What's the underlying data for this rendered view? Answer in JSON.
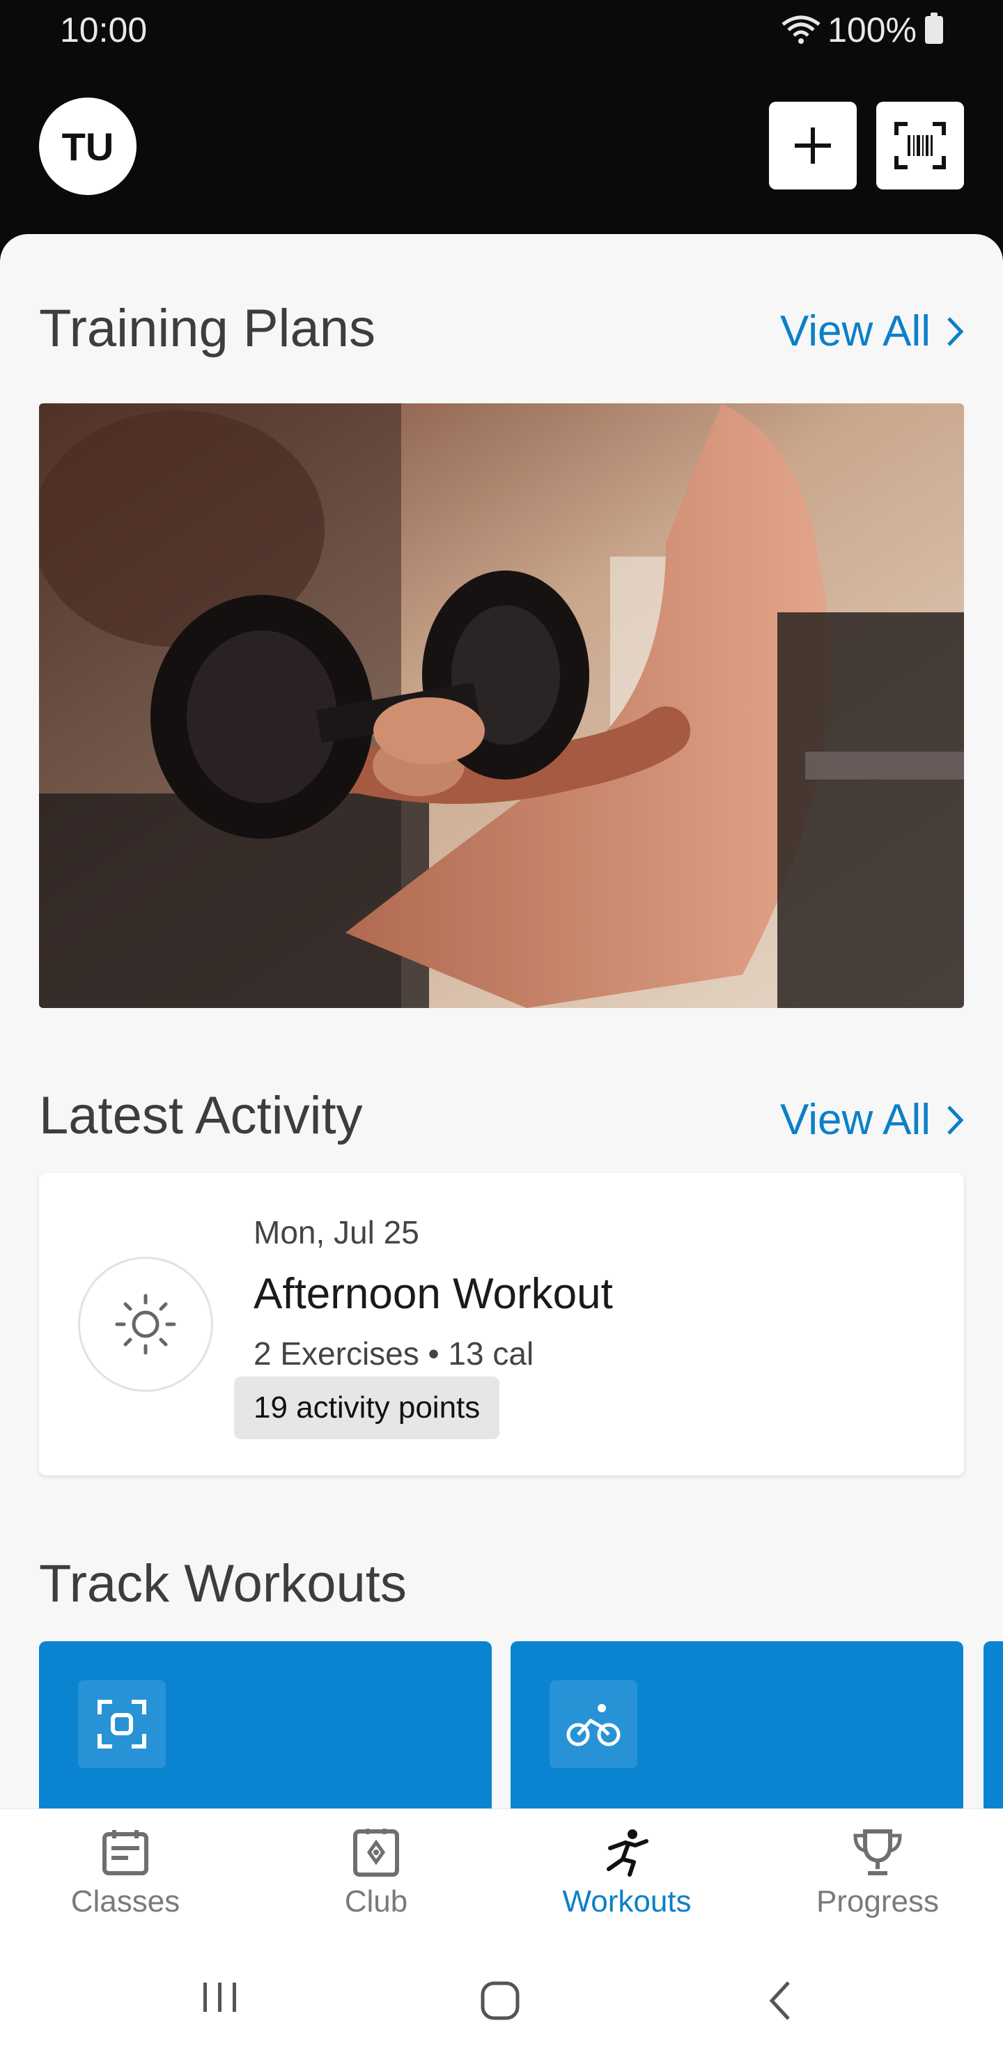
{
  "status_bar": {
    "time": "10:00",
    "battery": "100%"
  },
  "header": {
    "avatar_initials": "TU"
  },
  "training_plans": {
    "title": "Training Plans",
    "view_all": "View All"
  },
  "latest_activity": {
    "title": "Latest Activity",
    "view_all": "View All",
    "card": {
      "date": "Mon, Jul 25",
      "name": "Afternoon Workout",
      "meta": "2 Exercises • 13 cal",
      "badge": "19 activity points"
    }
  },
  "track_workouts": {
    "title": "Track Workouts"
  },
  "bottom_nav": {
    "items": [
      {
        "label": "Classes",
        "icon": "calendar-icon"
      },
      {
        "label": "Club",
        "icon": "club-icon"
      },
      {
        "label": "Workouts",
        "icon": "running-person-icon",
        "active": true
      },
      {
        "label": "Progress",
        "icon": "trophy-icon"
      }
    ]
  },
  "colors": {
    "accent": "#0b7fc9",
    "tile": "#0a84d1",
    "header_bg": "#0a0a0a"
  }
}
